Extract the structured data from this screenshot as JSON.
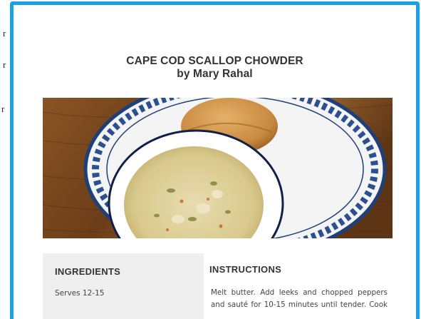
{
  "colors": {
    "frame_border": "#1aa3e0",
    "panel_bg": "#efefef",
    "text": "#333333"
  },
  "edge_glyphs": [
    "r",
    "r",
    "r"
  ],
  "recipe": {
    "title": "CAPE COD SCALLOP CHOWDER",
    "byline": "by Mary Rahal",
    "photo_icon": "chowder-photo"
  },
  "ingredients": {
    "heading": "INGREDIENTS",
    "serves": "Serves 12-15"
  },
  "instructions": {
    "heading": "INSTRUCTIONS",
    "lines": [
      "Melt butter. Add leeks and chopped peppers",
      "and sauté for 10-15 minutes until tender. Cook"
    ]
  }
}
